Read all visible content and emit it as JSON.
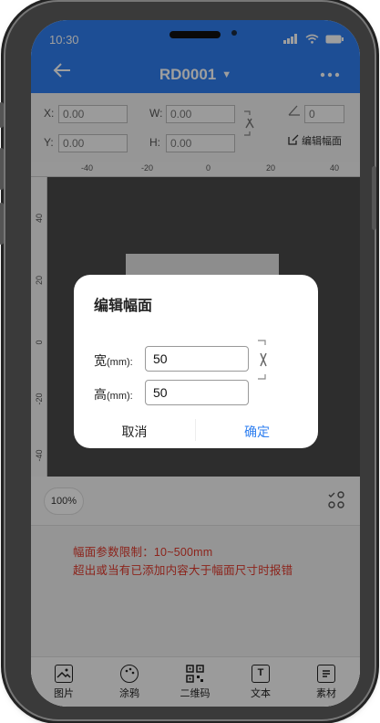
{
  "status": {
    "time": "10:30"
  },
  "header": {
    "title": "RD0001",
    "back_icon": "arrow-left-icon",
    "more_icon": "more-icon"
  },
  "props": {
    "x_label": "X:",
    "x_value": "0.00",
    "y_label": "Y:",
    "y_value": "0.00",
    "w_label": "W:",
    "w_value": "0.00",
    "h_label": "H:",
    "h_value": "0.00",
    "angle_value": "0",
    "edit_size_label": "编辑幅面"
  },
  "ruler": {
    "x_ticks": [
      "-40",
      "-20",
      "0",
      "20",
      "40"
    ],
    "y_ticks": [
      "40",
      "20",
      "0",
      "-20",
      "-40"
    ]
  },
  "zoom": {
    "level": "100%"
  },
  "info": {
    "line1": "幅面参数限制：10~500mm",
    "line2": "超出或当有已添加内容大于幅面尺寸时报错"
  },
  "toolbar": {
    "items": [
      {
        "label": "图片",
        "icon": "image-icon"
      },
      {
        "label": "涂鸦",
        "icon": "palette-icon"
      },
      {
        "label": "二维码",
        "icon": "qrcode-icon"
      },
      {
        "label": "文本",
        "icon": "text-icon"
      },
      {
        "label": "素材",
        "icon": "material-icon"
      }
    ]
  },
  "dialog": {
    "title": "编辑幅面",
    "width_label": "宽",
    "height_label": "高",
    "unit": "(mm):",
    "width_value": "50",
    "height_value": "50",
    "cancel_label": "取消",
    "confirm_label": "确定"
  },
  "colors": {
    "accent": "#2f7ff0",
    "warning_text": "#e23b2e"
  }
}
